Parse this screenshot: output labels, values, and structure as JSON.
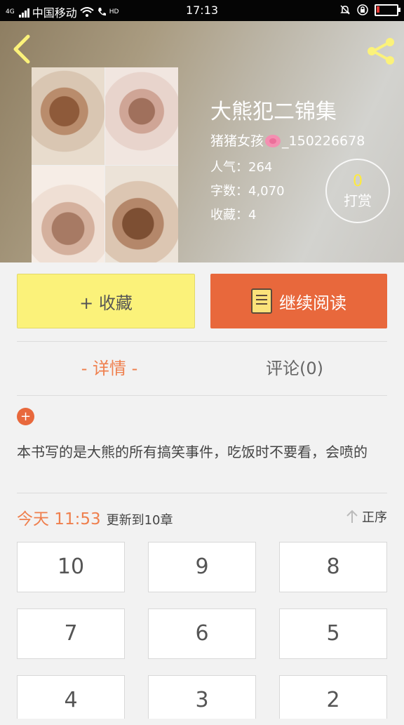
{
  "status_bar": {
    "network": "4G",
    "carrier": "中国移动",
    "hd": "HD",
    "time": "17:13"
  },
  "book": {
    "title": "大熊犯二锦集",
    "author_prefix": "猪猪女孩",
    "author_suffix": "_150226678",
    "stats": [
      {
        "label": "人气：",
        "value": "264"
      },
      {
        "label": "字数：",
        "value": "4,070"
      },
      {
        "label": "收藏：",
        "value": "4"
      }
    ]
  },
  "tip": {
    "count": "0",
    "label": "打赏"
  },
  "actions": {
    "favorite": "+ 收藏",
    "continue_reading": "继续阅读"
  },
  "tabs": {
    "detail": "- 详情 -",
    "comments": "评论(0)"
  },
  "description": "本书写的是大熊的所有搞笑事件，吃饭时不要看，会喷的",
  "update": {
    "date": "今天 11:53",
    "chapters": "更新到10章",
    "sort_label": "正序"
  },
  "chapters": [
    "10",
    "9",
    "8",
    "7",
    "6",
    "5",
    "4",
    "3",
    "2"
  ],
  "colors": {
    "accent": "#e8683c",
    "favorite_bg": "#fbf27a",
    "tip_number": "#ffeb3b"
  },
  "icons": {
    "back": "chevron-left-icon",
    "share": "share-icon",
    "book": "book-icon",
    "sort": "arrow-up-icon",
    "plus": "plus-icon"
  }
}
